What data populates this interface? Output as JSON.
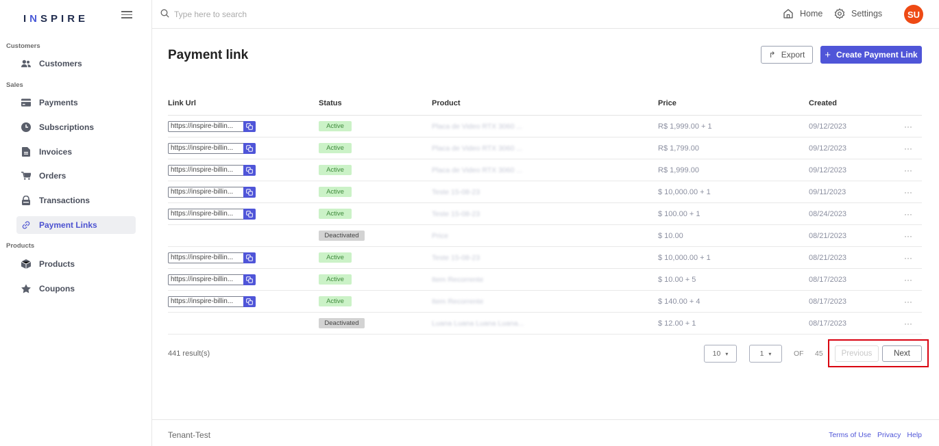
{
  "brand": {
    "logo_text_1": "I",
    "logo_accent": "N",
    "logo_text_2": "SPIRE"
  },
  "search": {
    "placeholder": "Type here to search"
  },
  "topnav": {
    "home_label": "Home",
    "settings_label": "Settings",
    "avatar_initials": "SU"
  },
  "sidebar": {
    "sections": [
      "Customers",
      "Sales",
      "Products"
    ],
    "items": [
      {
        "label": "Customers",
        "icon": "users-icon"
      },
      {
        "label": "Payments",
        "icon": "card-icon"
      },
      {
        "label": "Subscriptions",
        "icon": "clock-icon"
      },
      {
        "label": "Invoices",
        "icon": "file-icon"
      },
      {
        "label": "Orders",
        "icon": "cart-icon"
      },
      {
        "label": "Transactions",
        "icon": "lock-icon"
      },
      {
        "label": "Payment Links",
        "icon": "link-icon",
        "active": true
      },
      {
        "label": "Products",
        "icon": "box-icon"
      },
      {
        "label": "Coupons",
        "icon": "star-icon"
      }
    ]
  },
  "page": {
    "title": "Payment link",
    "export_label": "Export",
    "create_label": "Create Payment Link"
  },
  "table": {
    "columns": [
      "Link Url",
      "Status",
      "Product",
      "Price",
      "Created"
    ],
    "rows": [
      {
        "url": "https://inspire-billin...",
        "status": "Active",
        "product": "Placa de Video RTX 3060 ...",
        "price": "R$ 1,999.00 + 1",
        "created": "09/12/2023"
      },
      {
        "url": "https://inspire-billin...",
        "status": "Active",
        "product": "Placa de Video RTX 3060 ...",
        "price": "R$ 1,799.00",
        "created": "09/12/2023"
      },
      {
        "url": "https://inspire-billin...",
        "status": "Active",
        "product": "Placa de Video RTX 3060 ...",
        "price": "R$ 1,999.00",
        "created": "09/12/2023"
      },
      {
        "url": "https://inspire-billin...",
        "status": "Active",
        "product": "Teste 15-08-23",
        "price": "$ 10,000.00 + 1",
        "created": "09/11/2023"
      },
      {
        "url": "https://inspire-billin...",
        "status": "Active",
        "product": "Teste 15-08-23",
        "price": "$ 100.00 + 1",
        "created": "08/24/2023"
      },
      {
        "url": "",
        "status": "Deactivated",
        "product": "Price",
        "price": "$ 10.00",
        "created": "08/21/2023"
      },
      {
        "url": "https://inspire-billin...",
        "status": "Active",
        "product": "Teste 15-08-23",
        "price": "$ 10,000.00 + 1",
        "created": "08/21/2023"
      },
      {
        "url": "https://inspire-billin...",
        "status": "Active",
        "product": "Item Recorrente",
        "price": "$ 10.00 + 5",
        "created": "08/17/2023"
      },
      {
        "url": "https://inspire-billin...",
        "status": "Active",
        "product": "Item Recorrente",
        "price": "$ 140.00 + 4",
        "created": "08/17/2023"
      },
      {
        "url": "",
        "status": "Deactivated",
        "product": "Luana Luana Luana Luana...",
        "price": "$ 12.00 + 1",
        "created": "08/17/2023"
      }
    ],
    "row_action": "···"
  },
  "pagination": {
    "results_text": "441 result(s)",
    "page_size": "10",
    "current_page": "1",
    "of_label": "OF",
    "total_pages": "45",
    "prev_label": "Previous",
    "next_label": "Next"
  },
  "footer": {
    "tenant": "Tenant-Test",
    "terms": "Terms of Use",
    "privacy": "Privacy",
    "help": "Help"
  },
  "colors": {
    "accent": "#4f55d8",
    "avatar": "#ee4a14",
    "active_badge": "#cbf2c7",
    "highlight": "#d9000f"
  }
}
